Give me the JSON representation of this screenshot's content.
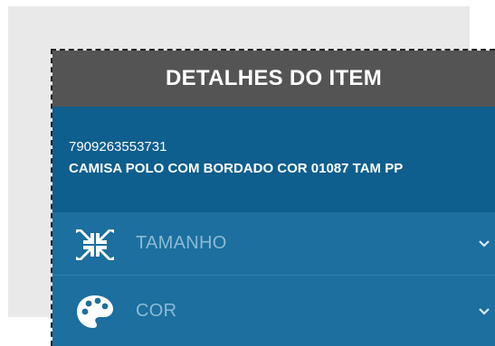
{
  "dialog": {
    "title": "DETALHES DO ITEM"
  },
  "item": {
    "code": "7909263553731",
    "description": "CAMISA POLO COM BORDADO COR 01087 TAM PP"
  },
  "options": [
    {
      "label": "TAMANHO",
      "icon": "compress-arrows-icon"
    },
    {
      "label": "COR",
      "icon": "palette-icon"
    }
  ],
  "colors": {
    "header_bg": "#545454",
    "item_bg": "#0e5e8e",
    "option_bg": "#1c6f9e",
    "option_text": "#8bbad6"
  }
}
